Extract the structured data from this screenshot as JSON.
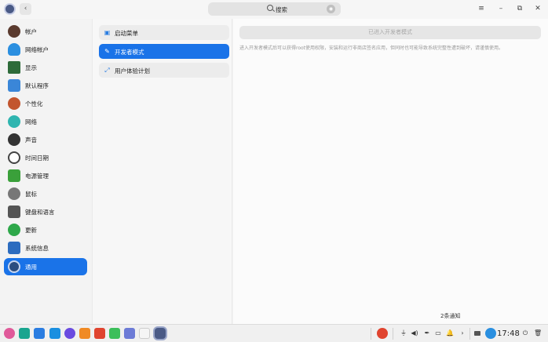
{
  "titlebar": {
    "back_glyph": "‹",
    "search_placeholder": "搜索",
    "menu_glyph": "≡",
    "minimize_glyph": "–",
    "restore_glyph": "⧉",
    "close_glyph": "✕"
  },
  "sidebar": {
    "items": [
      {
        "label": "帐户",
        "icon": "account-icon",
        "color": "#5a3a2e"
      },
      {
        "label": "网络帐户",
        "icon": "cloud-icon",
        "color": "#2b8fe0"
      },
      {
        "label": "显示",
        "icon": "monitor-icon",
        "color": "#2d6b3a"
      },
      {
        "label": "默认程序",
        "icon": "default-apps-icon",
        "color": "#3a86d8"
      },
      {
        "label": "个性化",
        "icon": "palette-icon",
        "color": "#c2552e"
      },
      {
        "label": "网络",
        "icon": "network-icon",
        "color": "#2fb5b0"
      },
      {
        "label": "声音",
        "icon": "speaker-icon",
        "color": "#333333"
      },
      {
        "label": "时间日期",
        "icon": "clock-icon",
        "color": "#444444"
      },
      {
        "label": "电源管理",
        "icon": "battery-icon",
        "color": "#3aa03a"
      },
      {
        "label": "鼠标",
        "icon": "mouse-icon",
        "color": "#777777"
      },
      {
        "label": "键盘和语言",
        "icon": "keyboard-icon",
        "color": "#555555"
      },
      {
        "label": "更新",
        "icon": "update-icon",
        "color": "#2ea84a"
      },
      {
        "label": "系统信息",
        "icon": "system-info-icon",
        "color": "#2c6cbf"
      },
      {
        "label": "通用",
        "icon": "general-icon",
        "color": "#2b4d80",
        "active": true
      }
    ]
  },
  "subpanel": {
    "items": [
      {
        "label": "启动菜单",
        "glyph": "▣"
      },
      {
        "label": "开发者模式",
        "glyph": "✎",
        "active": true
      },
      {
        "label": "用户体验计划",
        "glyph": "⤢"
      }
    ]
  },
  "content": {
    "dev_button": "已进入开发者模式",
    "description": "进入开发者模式后可以获得root使用权限，安装和运行非商店签名应用，但同时也可能导致系统完整性遭到破坏，请谨慎使用。"
  },
  "notification": "2条通知",
  "taskbar": {
    "apps": [
      {
        "icon": "launcher-icon",
        "color": "#e05a9a"
      },
      {
        "icon": "multitask-icon",
        "color": "#19a58f"
      },
      {
        "icon": "file-manager-icon",
        "color": "#2a7de1"
      },
      {
        "icon": "app-store-icon",
        "color": "#1a8fe0"
      },
      {
        "icon": "browser-icon",
        "color": "#6a4be0"
      },
      {
        "icon": "mail-icon",
        "color": "#f08a24"
      },
      {
        "icon": "photos-icon",
        "color": "#e0442f"
      },
      {
        "icon": "music-icon",
        "color": "#3cbf5a"
      },
      {
        "icon": "document-viewer-icon",
        "color": "#6c7bd6"
      },
      {
        "icon": "calendar-icon",
        "color": "#f5f5f5"
      },
      {
        "icon": "control-center-icon",
        "color": "#4a5a86",
        "active": true
      }
    ],
    "tray": {
      "usb_glyph": "⏚",
      "volume_glyph": "◀)",
      "pen_glyph": "✒",
      "battery_glyph": "▭",
      "bell_glyph": "🔔",
      "arrow_glyph": "›",
      "power_glyph": "⏻",
      "trash_glyph": "🗑"
    },
    "time": "17:48"
  }
}
